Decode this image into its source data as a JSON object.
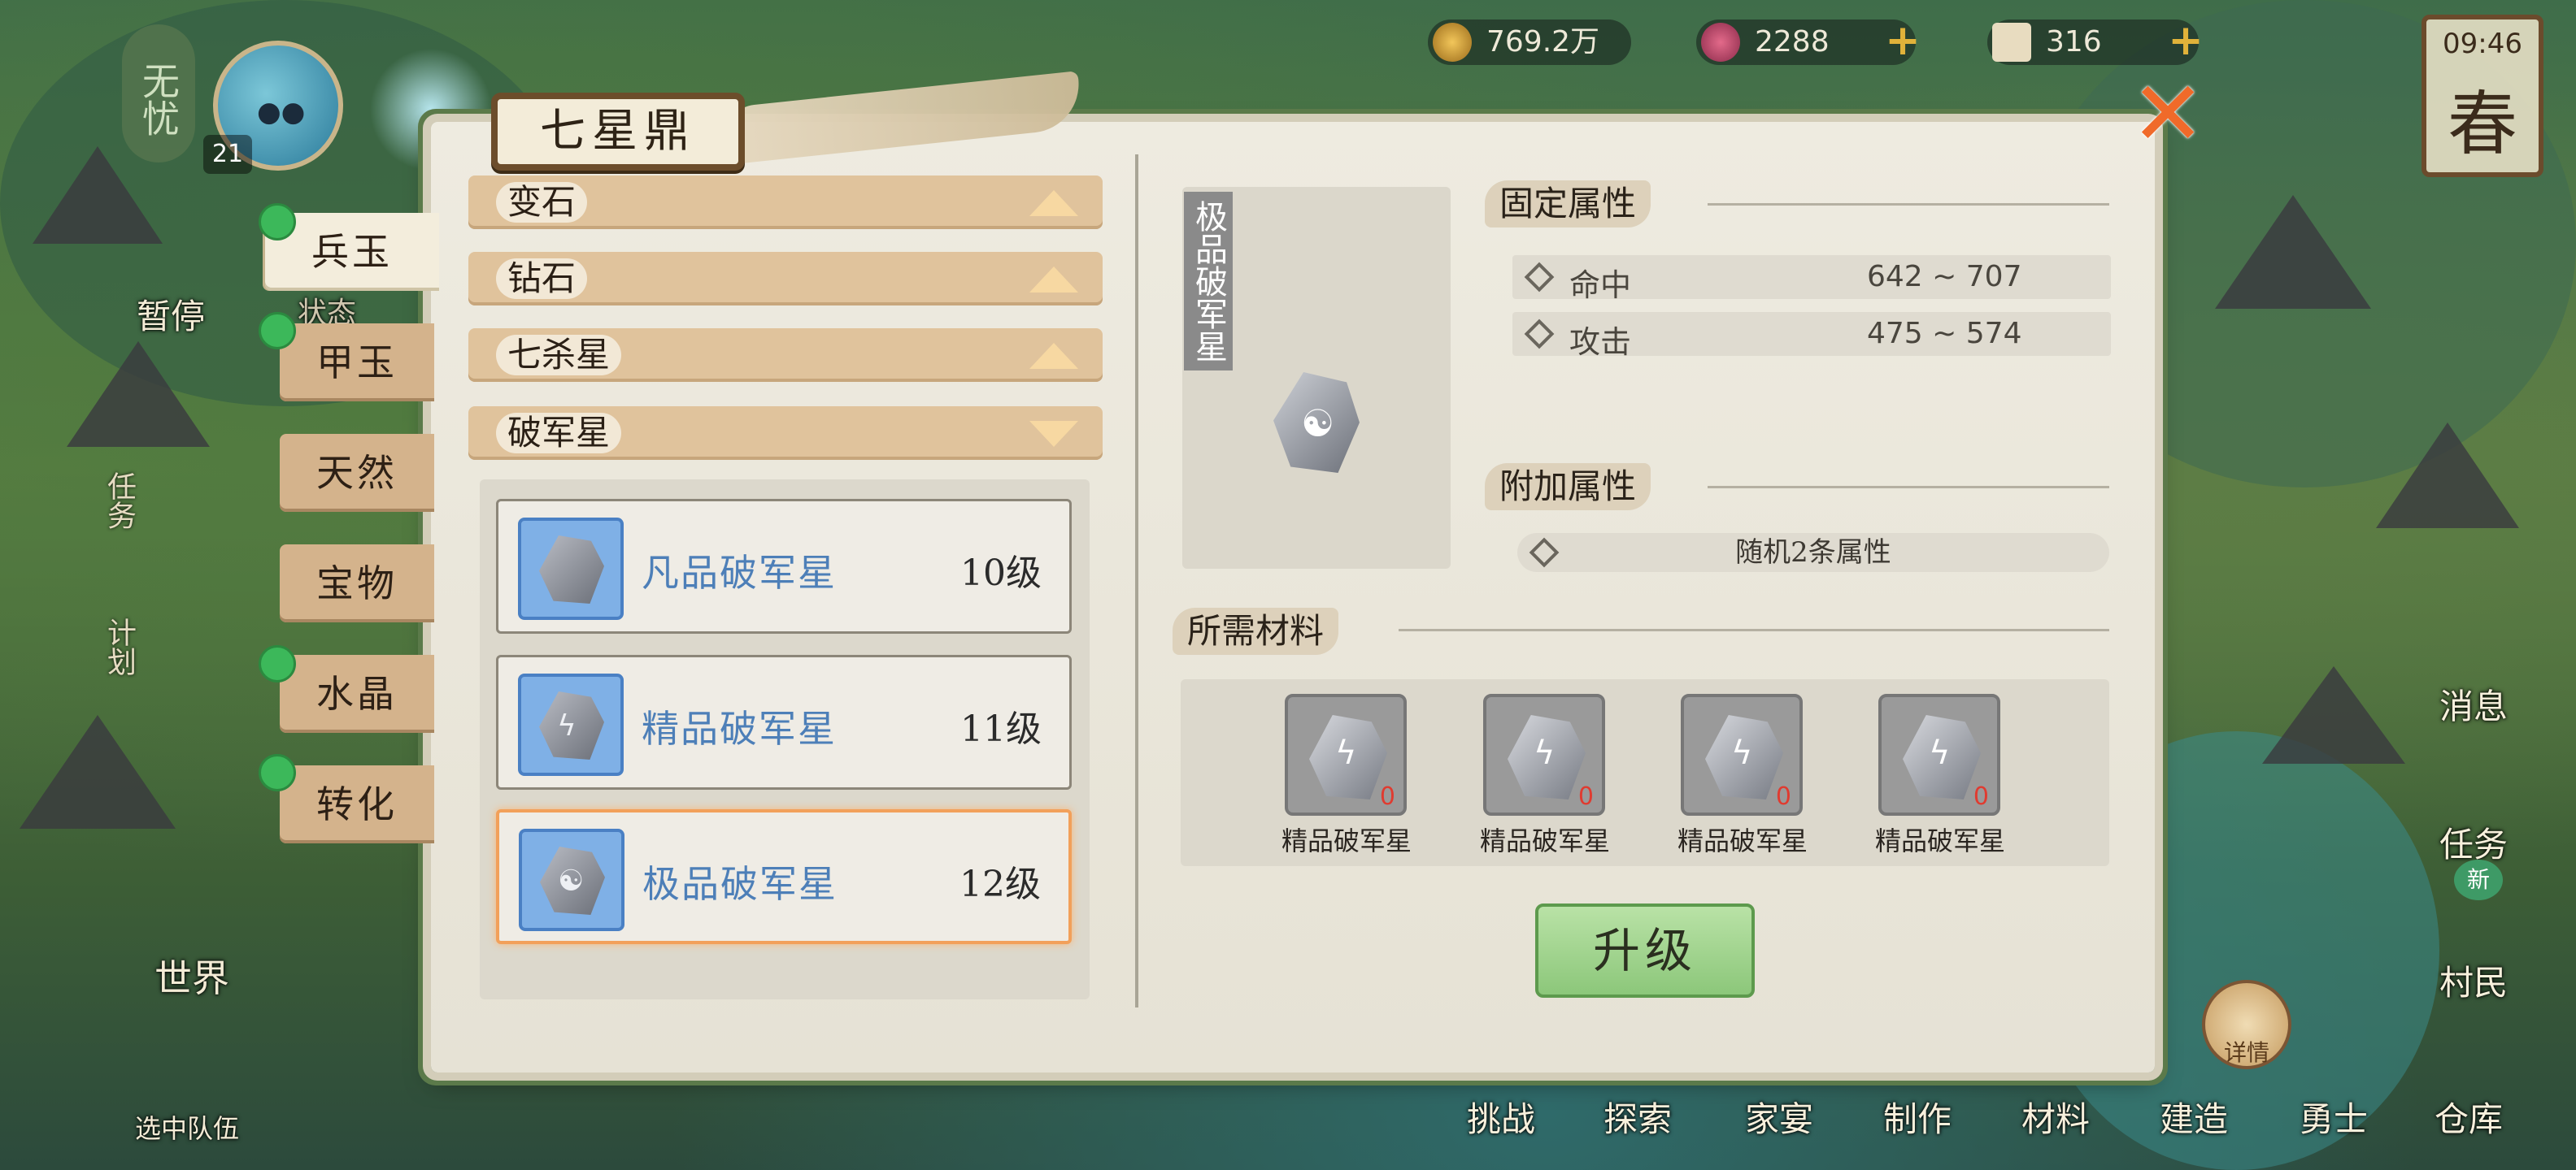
{
  "hud": {
    "coins": "769.2万",
    "gems": "2288",
    "tickets": "316",
    "time": "09:46",
    "season": "春",
    "player_tag": "无忧",
    "level": "21"
  },
  "side": {
    "pause": "暂停",
    "status": "状态",
    "task": "任务",
    "plan": "计划",
    "world": "世界",
    "select_team": "选中队伍"
  },
  "right_menu": {
    "message": "消息",
    "task": "任务",
    "villager": "村民",
    "new_badge": "新",
    "detail": "详情"
  },
  "bottom_menu": [
    "挑战",
    "探索",
    "家宴",
    "制作",
    "材料",
    "建造",
    "勇士",
    "仓库"
  ],
  "panel": {
    "title": "七星鼎",
    "tabs": [
      "兵玉",
      "甲玉",
      "天然",
      "宝物",
      "水晶",
      "转化"
    ],
    "categories": [
      {
        "label": "变石",
        "expanded": false
      },
      {
        "label": "钻石",
        "expanded": false
      },
      {
        "label": "七杀星",
        "expanded": false
      },
      {
        "label": "破军星",
        "expanded": true
      }
    ],
    "items": [
      {
        "name": "凡品破军星",
        "level": "10级"
      },
      {
        "name": "精品破军星",
        "level": "11级"
      },
      {
        "name": "极品破军星",
        "level": "12级",
        "selected": true
      }
    ],
    "detail": {
      "item_title": "极品破军星",
      "fixed_title": "固定属性",
      "fixed_attrs": [
        {
          "name": "命中",
          "value": "642 ~ 707"
        },
        {
          "name": "攻击",
          "value": "475 ~ 574"
        }
      ],
      "extra_title": "附加属性",
      "extra_text": "随机2条属性",
      "materials_title": "所需材料",
      "materials": [
        {
          "name": "精品破军星",
          "count": "0"
        },
        {
          "name": "精品破军星",
          "count": "0"
        },
        {
          "name": "精品破军星",
          "count": "0"
        },
        {
          "name": "精品破军星",
          "count": "0"
        }
      ],
      "upgrade_label": "升级"
    }
  },
  "colors": {
    "accent_green": "#3cb85a",
    "item_blue": "#4d7fb8",
    "close_orange": "#f06a2a",
    "selected_border": "#f2a05a"
  }
}
